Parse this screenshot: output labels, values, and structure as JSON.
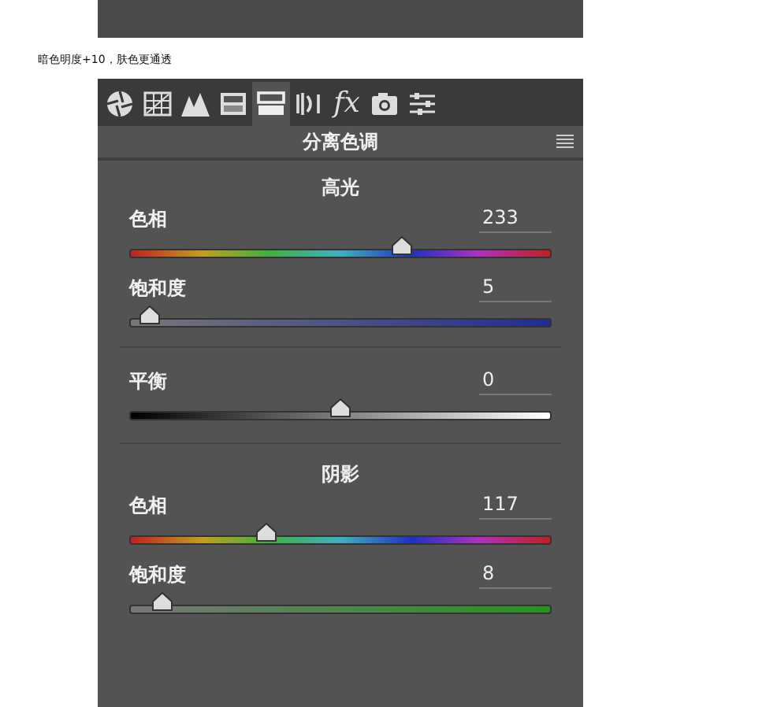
{
  "caption": "暗色明度+10，肤色更通透",
  "tabs": [
    {
      "kind": "aperture",
      "selected": false
    },
    {
      "kind": "grid",
      "selected": false
    },
    {
      "kind": "peaks",
      "selected": false
    },
    {
      "kind": "gradient",
      "selected": false
    },
    {
      "kind": "split",
      "selected": true
    },
    {
      "kind": "lens",
      "selected": false
    },
    {
      "kind": "fx",
      "label": "fx",
      "selected": false
    },
    {
      "kind": "camera",
      "selected": false
    },
    {
      "kind": "sliders",
      "selected": false
    }
  ],
  "panel": {
    "title": "分离色调"
  },
  "sections": [
    {
      "heading": "高光",
      "sliders": [
        {
          "kind": "hue",
          "label": "色相",
          "value": "233",
          "level": 0.647
        },
        {
          "kind": "saturation",
          "label": "饱和度",
          "value": "5",
          "level": 0.05
        }
      ]
    },
    {
      "sliders": [
        {
          "kind": "balance",
          "label": "平衡",
          "value": "0",
          "level": 0.5
        }
      ]
    },
    {
      "heading": "阴影",
      "sliders": [
        {
          "kind": "hue",
          "label": "色相",
          "value": "117",
          "level": 0.325
        },
        {
          "kind": "saturation",
          "label": "饱和度",
          "value": "8",
          "level": 0.08
        }
      ]
    }
  ]
}
